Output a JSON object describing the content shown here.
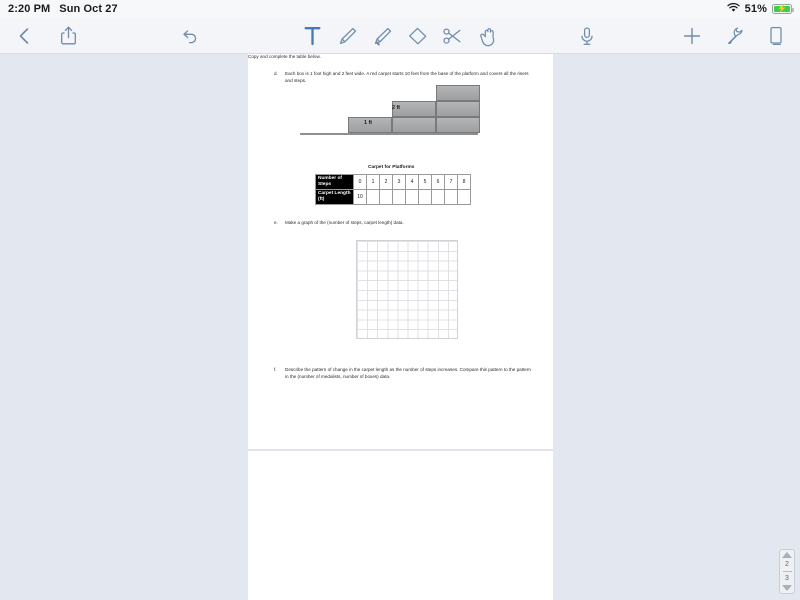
{
  "status_bar": {
    "time": "2:20 PM",
    "date": "Sun Oct 27",
    "wifi_icon": "wifi-icon",
    "battery_percent": "51%",
    "battery_icon": "battery-charging-icon",
    "battery_color": "#3ad04a"
  },
  "toolbar": {
    "back_icon": "back-chevron-icon",
    "share_icon": "share-icon",
    "undo_icon": "undo-icon",
    "text_tool_icon": "text-tool-icon",
    "pen_icon": "pen-icon",
    "highlighter_icon": "highlighter-icon",
    "eraser_icon": "eraser-icon",
    "scissors_icon": "scissors-icon",
    "hand_icon": "hand-tool-icon",
    "mic_icon": "microphone-icon",
    "add_icon": "plus-icon",
    "settings_icon": "wrench-icon",
    "pages_icon": "pages-icon",
    "accent_color": "#6e8bab",
    "active_color": "#4a79b5"
  },
  "worksheet": {
    "question_d": {
      "marker": "d.",
      "text": "Each box is 1 foot high and 2 feet wide.  A red carpet starts 10 feet from the base of the platform and covers all the risers and steps."
    },
    "figure": {
      "label_height": "1 ft",
      "label_width": "2 ft"
    },
    "copy_instruction": "Copy and complete the table below.",
    "table": {
      "title": "Carpet for Platforms",
      "rows": [
        {
          "header": "Number of Steps",
          "values": [
            "0",
            "1",
            "2",
            "3",
            "4",
            "5",
            "6",
            "7",
            "8"
          ]
        },
        {
          "header": "Carpet Length (ft)",
          "values": [
            "10",
            "",
            "",
            "",
            "",
            "",
            "",
            "",
            ""
          ]
        }
      ]
    },
    "question_e": {
      "marker": "e.",
      "text": "Make a graph of the (number of steps, carpet length) data."
    },
    "question_f": {
      "marker": "f.",
      "text": "Describe the pattern of change in the carpet length as the number of steps increases. Compare this pattern to the pattern in the (number of medalists, number of boxes) data."
    }
  },
  "page_stepper": {
    "up_icon": "triangle-up-icon",
    "current_page": "2",
    "total_pages": "3",
    "down_icon": "triangle-down-icon"
  }
}
